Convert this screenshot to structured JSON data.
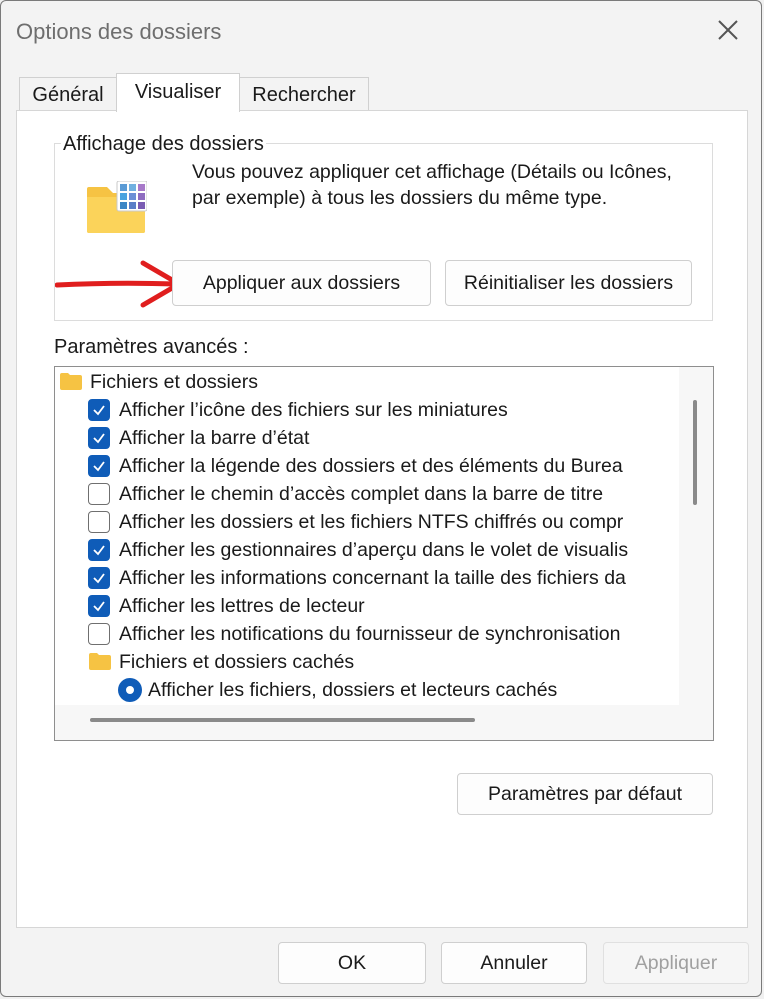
{
  "window": {
    "title": "Options des dossiers"
  },
  "tabs": [
    {
      "label": "Général",
      "active": false
    },
    {
      "label": "Visualiser",
      "active": true
    },
    {
      "label": "Rechercher",
      "active": false
    }
  ],
  "folder_view": {
    "group_title": "Affichage des dossiers",
    "description": "Vous pouvez appliquer cet affichage (Détails ou Icônes, par exemple) à tous les dossiers du même type.",
    "apply_button": "Appliquer aux dossiers",
    "reset_button": "Réinitialiser les dossiers"
  },
  "advanced": {
    "label": "Paramètres avancés :",
    "items": [
      {
        "kind": "folder",
        "label": "Fichiers et dossiers"
      },
      {
        "kind": "checkbox",
        "checked": true,
        "label": "Afficher l’icône des fichiers sur les miniatures"
      },
      {
        "kind": "checkbox",
        "checked": true,
        "label": "Afficher la barre d’état"
      },
      {
        "kind": "checkbox",
        "checked": true,
        "label": "Afficher la légende des dossiers et des éléments du Burea"
      },
      {
        "kind": "checkbox",
        "checked": false,
        "label": "Afficher le chemin d’accès complet dans la barre de titre"
      },
      {
        "kind": "checkbox",
        "checked": false,
        "label": "Afficher les dossiers et les fichiers NTFS chiffrés ou compr"
      },
      {
        "kind": "checkbox",
        "checked": true,
        "label": "Afficher les gestionnaires d’aperçu dans le volet de visualis"
      },
      {
        "kind": "checkbox",
        "checked": true,
        "label": "Afficher les informations concernant la taille des fichiers da"
      },
      {
        "kind": "checkbox",
        "checked": true,
        "label": "Afficher les lettres de lecteur"
      },
      {
        "kind": "checkbox",
        "checked": false,
        "label": "Afficher les notifications du fournisseur de synchronisation"
      },
      {
        "kind": "subfolder",
        "label": "Fichiers et dossiers cachés"
      },
      {
        "kind": "radio",
        "checked": true,
        "label": "Afficher les fichiers, dossiers et lecteurs cachés"
      }
    ]
  },
  "defaults_button": "Paramètres par défaut",
  "footer": {
    "ok": "OK",
    "cancel": "Annuler",
    "apply": "Appliquer"
  },
  "colors": {
    "accent": "#0f5cb8",
    "arrow": "#e01e1e",
    "folder": "#f6c343"
  },
  "icons": [
    "close-icon",
    "folder-view-icon",
    "red-arrow-icon",
    "folder-icon",
    "checkmark-icon"
  ]
}
